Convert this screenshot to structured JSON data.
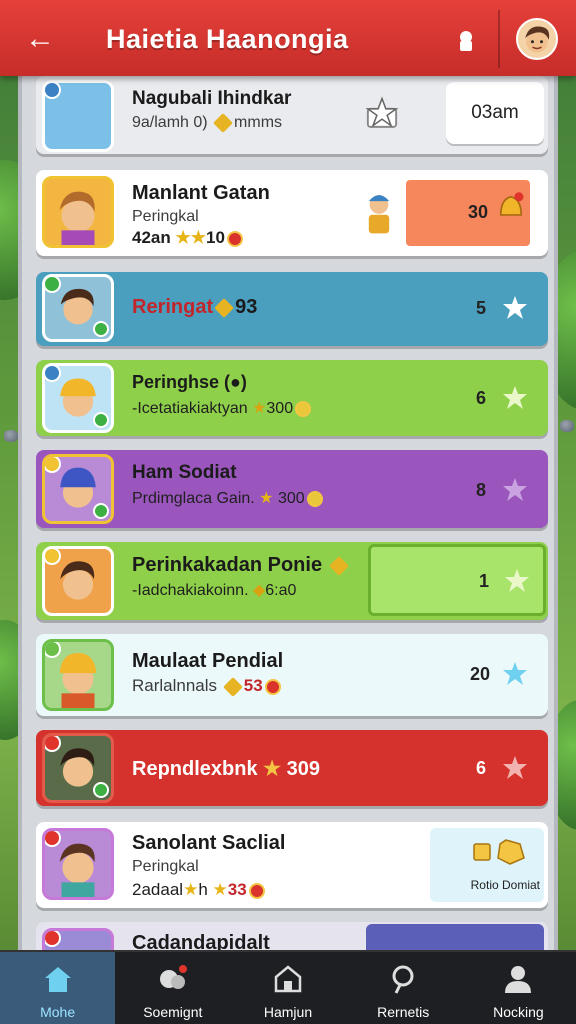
{
  "header": {
    "title": "Haietia Haanongia"
  },
  "rows": [
    {
      "name": "Nagubali Ihindkar",
      "sub": "9a/lamh 0) ",
      "sub_tail": "mmms",
      "button": "03am"
    },
    {
      "name": "Manlant Gatan",
      "sub": "Peringkal",
      "stat": "42an",
      "stat2": "10",
      "rank": "30"
    },
    {
      "name": "Reringat",
      "stat": "93",
      "rank": "5"
    },
    {
      "name": "Peringhse",
      "sub": "-Icetatiakiaktyan",
      "stat": "300",
      "rank": "6"
    },
    {
      "name": "Ham Sodiat",
      "sub": "Prdimglaca Gain.",
      "stat": "300",
      "rank": "8"
    },
    {
      "name": "Perinkakadan Ponie",
      "sub": "-Iadchakiakoinn.",
      "stat": "6:a0",
      "rank": "1"
    },
    {
      "name": "Maulaat Pendial",
      "sub": "Rarlalnnals",
      "stat": "53",
      "rank": "20"
    },
    {
      "name": "Repndlexbnk",
      "stat": "309",
      "rank": "6"
    },
    {
      "name": "Sanolant Saclial",
      "sub": "Peringkal",
      "stat": "2adaal",
      "stat2": "33",
      "reward_label": "Rotio Domiat"
    },
    {
      "name": "Cadandapidalt"
    }
  ],
  "nav": [
    {
      "label": "Mohe",
      "icon": "home-icon"
    },
    {
      "label": "Soemignt",
      "icon": "social-icon"
    },
    {
      "label": "Hamjun",
      "icon": "house-icon"
    },
    {
      "label": "Rernetis",
      "icon": "search-icon"
    },
    {
      "label": "Nocking",
      "icon": "profile-icon"
    }
  ],
  "colors": {
    "header": "#d9362f",
    "accent_green": "#8ed04a",
    "accent_purple": "#8c4fb0",
    "accent_blue": "#4aa3c7",
    "accent_red": "#d6322d"
  }
}
